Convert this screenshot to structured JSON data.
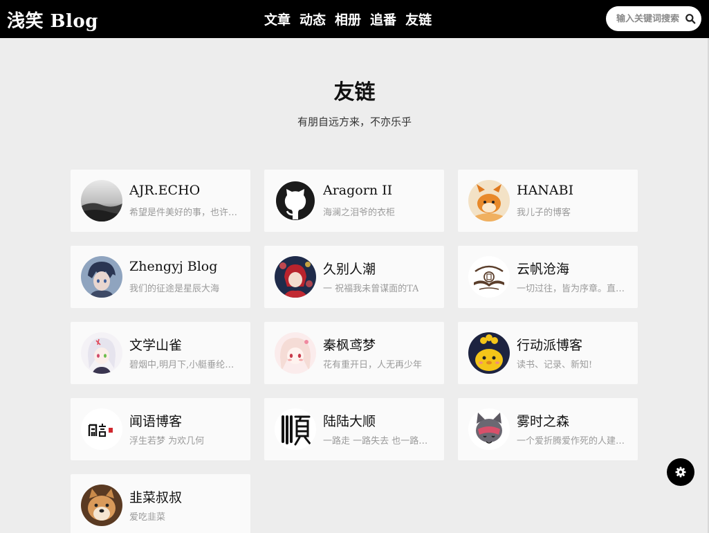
{
  "header": {
    "brand": "浅笑 Blog",
    "nav": [
      "文章",
      "动态",
      "相册",
      "追番",
      "友链"
    ],
    "search": {
      "placeholder": "输入关键词搜索",
      "value": ""
    }
  },
  "page": {
    "title": "友链",
    "subtitle": "有朋自远方来，不亦乐乎"
  },
  "links": [
    {
      "name": "AJR.ECHO",
      "desc": "希望是件美好的事，也许是人间至善",
      "avatar": "misty-landscape-avatar"
    },
    {
      "name": "Aragorn II",
      "desc": "海澜之泪爷的衣柜",
      "avatar": "github-icon"
    },
    {
      "name": "HANABI",
      "desc": "我儿子的博客",
      "avatar": "fox-avatar"
    },
    {
      "name": "Zhengyj Blog",
      "desc": "我们的征途是星辰大海",
      "avatar": "anime-boy-avatar"
    },
    {
      "name": "久别人潮",
      "desc": "一 祝福我未曾谋面的TA",
      "avatar": "anime-girl-red-avatar"
    },
    {
      "name": "云帆沧海",
      "desc": "一切过往，皆为序章。直挂云帆济沧海",
      "avatar": "seal-logo-avatar"
    },
    {
      "name": "文学山雀",
      "desc": "碧烟中,明月下,小艇垂纶初罢",
      "avatar": "white-hair-girl-avatar"
    },
    {
      "name": "秦枫鸢梦",
      "desc": "花有重开日，人无再少年",
      "avatar": "blush-girl-avatar"
    },
    {
      "name": "行动派博客",
      "desc": "读书、记录、新知!",
      "avatar": "yellow-mascot-avatar"
    },
    {
      "name": "闻语博客",
      "desc": "浮生若梦 为欢几何",
      "avatar": "calligraphy-avatar"
    },
    {
      "name": "陆陆大顺",
      "desc": "一路走 一路失去 也一路收获",
      "avatar": "shun-character-avatar"
    },
    {
      "name": "雾时之森",
      "desc": "一个爱折腾爱作死的人建的博客",
      "avatar": "grey-cat-avatar"
    },
    {
      "name": "韭菜叔叔",
      "desc": "爱吃韭菜",
      "avatar": "shiba-dog-avatar"
    }
  ],
  "controls": {
    "settings_icon": "gear-icon"
  }
}
